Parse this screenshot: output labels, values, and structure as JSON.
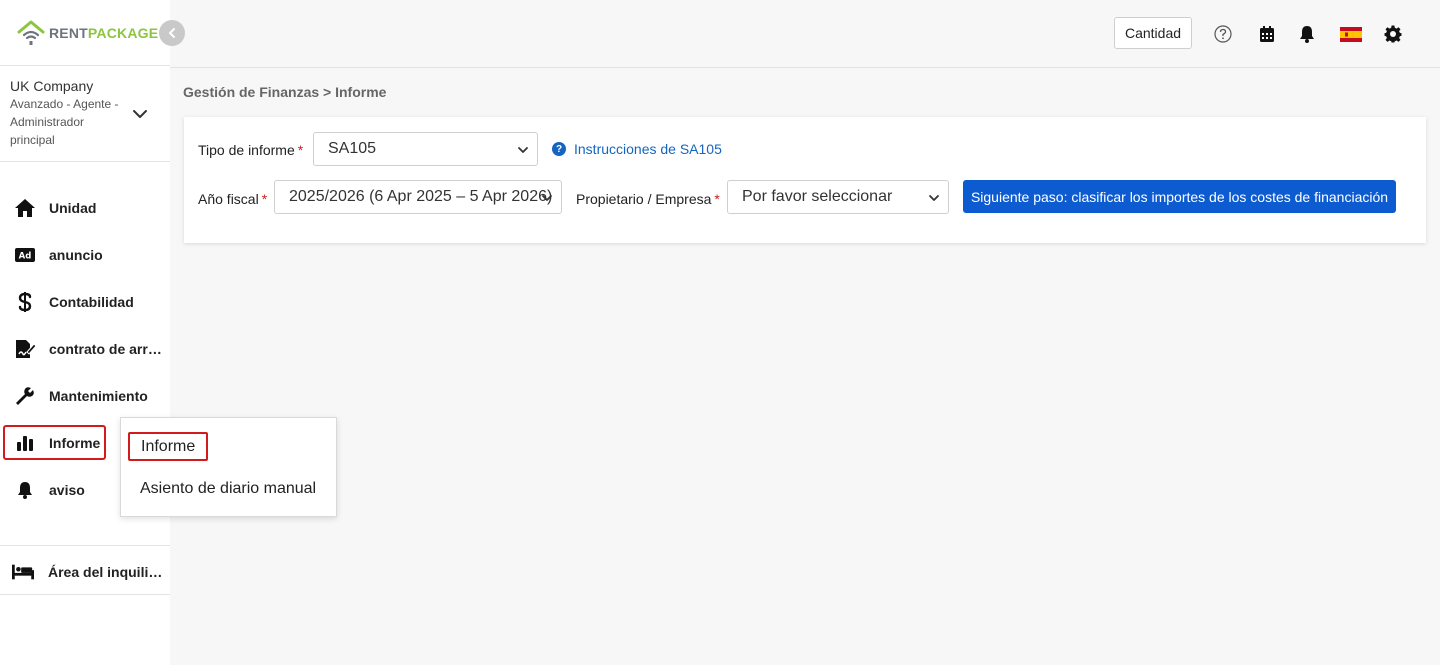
{
  "brand": {
    "part1": "RENT",
    "part2": "PACKAGE",
    "rent_color": "#6c757d",
    "package_color": "#8cc63f"
  },
  "company": {
    "name": "UK Company",
    "role": "Avanzado - Agente - Administrador principal"
  },
  "sidebar": {
    "items": [
      {
        "label": "Unidad",
        "icon": "home-icon"
      },
      {
        "label": "anuncio",
        "icon": "ad-icon"
      },
      {
        "label": "Contabilidad",
        "icon": "dollar-icon"
      },
      {
        "label": "contrato de arrendamiento",
        "icon": "contract-icon"
      },
      {
        "label": "Mantenimiento",
        "icon": "wrench-icon"
      },
      {
        "label": "Informe",
        "icon": "bar-chart-icon",
        "active": true
      },
      {
        "label": "aviso",
        "icon": "bell-icon"
      }
    ],
    "tenant_area": {
      "label": "Área del inquilino",
      "icon": "bed-icon"
    }
  },
  "popup_menu": {
    "items": [
      "Informe",
      "Asiento de diario manual"
    ]
  },
  "header": {
    "quantity_button": "Cantidad",
    "icons": [
      "help-icon",
      "calendar-icon",
      "bell-icon",
      "spain-flag-icon",
      "gear-icon"
    ]
  },
  "breadcrumb": "Gestión de Finanzas > Informe",
  "form": {
    "report_type_label": "Tipo de informe",
    "report_type_value": "SA105",
    "instructions_link": "Instrucciones de SA105",
    "fiscal_year_label": "Año fiscal",
    "fiscal_year_value": "2025/2026 (6 Apr 2025 – 5 Apr 2026)",
    "owner_label": "Propietario / Empresa",
    "owner_value": "Por favor seleccionar",
    "next_button": "Siguiente paso: clasificar los importes de los costes de financiación"
  },
  "colors": {
    "accent": "#0d5bd1",
    "highlight": "#d01c1c",
    "link": "#1565c0"
  }
}
